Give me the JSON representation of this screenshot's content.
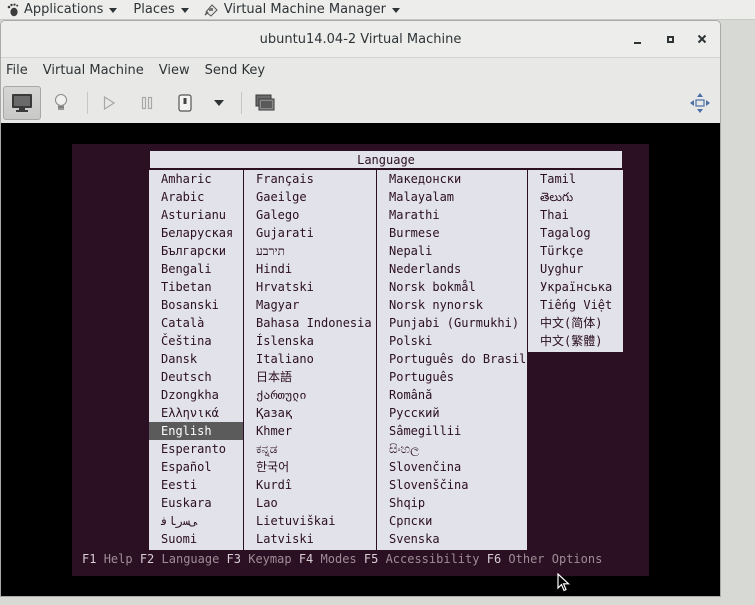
{
  "top_panel": {
    "applications_label": "Applications",
    "places_label": "Places",
    "app_label": "Virtual Machine Manager"
  },
  "window": {
    "title": "ubuntu14.04-2 Virtual Machine",
    "menu": [
      "File",
      "Virtual Machine",
      "View",
      "Send Key"
    ],
    "toolbar_icons": [
      "console-icon",
      "details-lightbulb-icon",
      "run-icon",
      "pause-icon",
      "power-icon",
      "chevron-down-icon",
      "snapshot-icon",
      "fullscreen-icon"
    ]
  },
  "installer": {
    "dialog_title": "Language",
    "selected_language": "English",
    "columns": [
      [
        "Amharic",
        "Arabic",
        "Asturianu",
        "Беларуская",
        "Български",
        "Bengali",
        "Tibetan",
        "Bosanski",
        "Català",
        "Čeština",
        "Dansk",
        "Deutsch",
        "Dzongkha",
        "Ελληνικά",
        "English",
        "Esperanto",
        "Español",
        "Eesti",
        "Euskara",
        "ﻰﺳﺭﺎﻓ",
        "Suomi"
      ],
      [
        "Français",
        "Gaeilge",
        "Galego",
        "Gujarati",
        "תירבע",
        "Hindi",
        "Hrvatski",
        "Magyar",
        "Bahasa Indonesia",
        "Íslenska",
        "Italiano",
        "日本語",
        "ქართული",
        "Қазақ",
        "Khmer",
        "ಕನ್ನಡ",
        "한국어",
        "Kurdî",
        "Lao",
        "Lietuviškai",
        "Latviski"
      ],
      [
        "Македонски",
        "Malayalam",
        "Marathi",
        "Burmese",
        "Nepali",
        "Nederlands",
        "Norsk bokmål",
        "Norsk nynorsk",
        "Punjabi (Gurmukhi)",
        "Polski",
        "Português do Brasil",
        "Português",
        "Română",
        "Русский",
        "Sâmegillii",
        "සිංහල",
        "Slovenčina",
        "Slovenščina",
        "Shqip",
        "Српски",
        "Svenska"
      ],
      [
        "Tamil",
        "తెలుగు",
        "Thai",
        "Tagalog",
        "Türkçe",
        "Uyghur",
        "Українська",
        "Tiếng Việt",
        "中文(简体)",
        "中文(繁體)"
      ]
    ],
    "function_keys": [
      {
        "key": "F1",
        "label": "Help"
      },
      {
        "key": "F2",
        "label": "Language"
      },
      {
        "key": "F3",
        "label": "Keymap"
      },
      {
        "key": "F4",
        "label": "Modes"
      },
      {
        "key": "F5",
        "label": "Accessibility"
      },
      {
        "key": "F6",
        "label": "Other Options"
      }
    ]
  },
  "colors": {
    "installer_bg": "#2b0f22",
    "list_bg": "#e2e2ea",
    "selection_bg": "#5b5b5b"
  }
}
